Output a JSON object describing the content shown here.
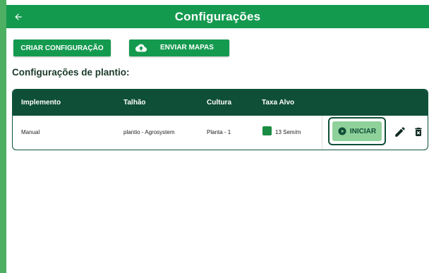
{
  "header": {
    "title": "Configurações",
    "back_icon": "arrow-left-icon"
  },
  "toolbar": {
    "create_label": "CRIAR CONFIGURAÇÃO",
    "send_label": "ENVIAR MAPAS",
    "send_icon": "cloud-upload-icon"
  },
  "section": {
    "title": "Configurações de plantio:"
  },
  "table": {
    "columns": [
      "Implemento",
      "Talhão",
      "Cultura",
      "Taxa Alvo"
    ],
    "rows": [
      {
        "implemento": "Manual",
        "talhao": "plantio - Agrosystem",
        "cultura": "Planta - 1",
        "taxa_alvo": "13 Sem/m",
        "rate_color": "#1a8c44",
        "start_label": "INICIAR",
        "start_icon": "play-icon",
        "edit_icon": "pencil-icon",
        "delete_icon": "trash-icon"
      }
    ]
  },
  "colors": {
    "primary": "#149a4f",
    "table_header": "#0f4e37",
    "start_button": "#8fd19a"
  }
}
